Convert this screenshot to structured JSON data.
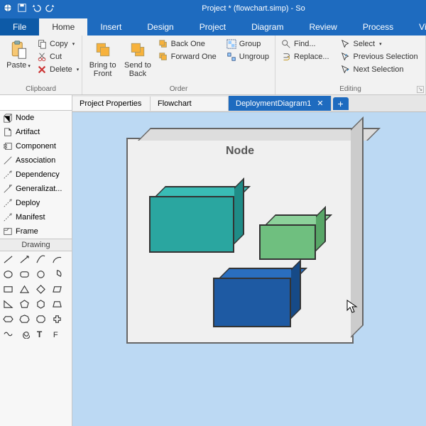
{
  "title": "Project * (flowchart.simp) - So",
  "tabs": {
    "file": "File",
    "home": "Home",
    "insert": "Insert",
    "design": "Design",
    "project": "Project",
    "diagram": "Diagram",
    "review": "Review",
    "process": "Process",
    "view": "View"
  },
  "ribbon": {
    "clipboard": {
      "label": "Clipboard",
      "paste": "Paste",
      "copy": "Copy",
      "cut": "Cut",
      "delete": "Delete"
    },
    "order": {
      "label": "Order",
      "bringFront": "Bring to\nFront",
      "sendBack": "Send to\nBack",
      "backOne": "Back One",
      "forwardOne": "Forward One",
      "group": "Group",
      "ungroup": "Ungroup"
    },
    "editing": {
      "label": "Editing",
      "find": "Find...",
      "replace": "Replace...",
      "select": "Select",
      "prevSel": "Previous Selection",
      "nextSel": "Next Selection"
    }
  },
  "palette": {
    "items": [
      {
        "label": "Node"
      },
      {
        "label": "Artifact"
      },
      {
        "label": "Component"
      },
      {
        "label": "Association"
      },
      {
        "label": "Dependency"
      },
      {
        "label": "Generalizat..."
      },
      {
        "label": "Deploy"
      },
      {
        "label": "Manifest"
      },
      {
        "label": "Frame"
      }
    ],
    "drawing": "Drawing"
  },
  "doctabs": {
    "t1": "Project Properties",
    "t2": "Flowchart",
    "t3": "DeploymentDiagram1"
  },
  "canvas": {
    "nodeLabel": "Node"
  }
}
